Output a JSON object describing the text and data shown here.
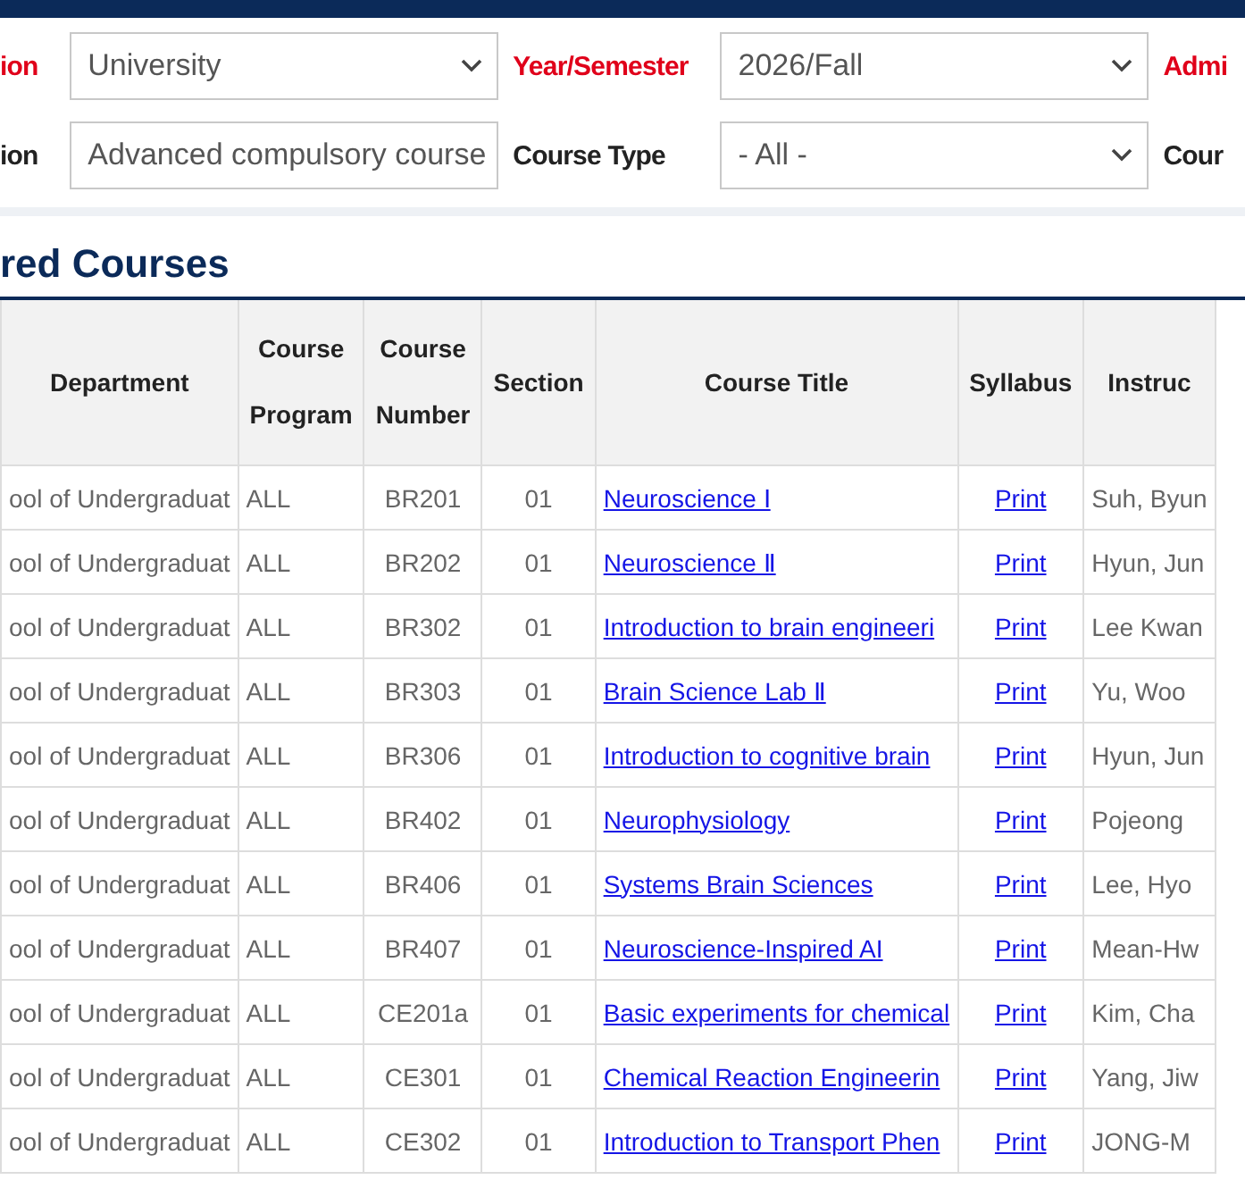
{
  "filters": [
    {
      "label": "ion",
      "required": true,
      "value": "University"
    },
    {
      "label": "Year/Semester",
      "required": true,
      "value": "2026/Fall"
    },
    {
      "label": "Admi",
      "required": true
    },
    {
      "label": "ion",
      "required": false,
      "value": "Advanced compulsory course"
    },
    {
      "label": "Course Type",
      "required": false,
      "value": "- All -"
    },
    {
      "label": "Cour",
      "required": false
    }
  ],
  "section_title": "red Courses",
  "table": {
    "columns": [
      [
        "Department"
      ],
      [
        "Course",
        "Program"
      ],
      [
        "Course",
        "Number"
      ],
      [
        "Section"
      ],
      [
        "Course Title"
      ],
      [
        "Syllabus"
      ],
      [
        "Instruc"
      ]
    ],
    "rows": [
      {
        "department": "ool of Undergraduat",
        "program": "ALL",
        "number": "BR201",
        "section": "01",
        "title": "Neuroscience Ⅰ",
        "syllabus": "Print",
        "instructor": "Suh, Byun"
      },
      {
        "department": "ool of Undergraduat",
        "program": "ALL",
        "number": "BR202",
        "section": "01",
        "title": "Neuroscience Ⅱ",
        "syllabus": "Print",
        "instructor": "Hyun, Jun"
      },
      {
        "department": "ool of Undergraduat",
        "program": "ALL",
        "number": "BR302",
        "section": "01",
        "title": "Introduction to brain engineeri",
        "syllabus": "Print",
        "instructor": "Lee Kwan"
      },
      {
        "department": "ool of Undergraduat",
        "program": "ALL",
        "number": "BR303",
        "section": "01",
        "title": "Brain Science Lab Ⅱ",
        "syllabus": "Print",
        "instructor": "Yu, Woo"
      },
      {
        "department": "ool of Undergraduat",
        "program": "ALL",
        "number": "BR306",
        "section": "01",
        "title": "Introduction to cognitive brain",
        "syllabus": "Print",
        "instructor": "Hyun, Jun"
      },
      {
        "department": "ool of Undergraduat",
        "program": "ALL",
        "number": "BR402",
        "section": "01",
        "title": "Neurophysiology",
        "syllabus": "Print",
        "instructor": "Pojeong"
      },
      {
        "department": "ool of Undergraduat",
        "program": "ALL",
        "number": "BR406",
        "section": "01",
        "title": "Systems Brain Sciences",
        "syllabus": "Print",
        "instructor": "Lee, Hyo"
      },
      {
        "department": "ool of Undergraduat",
        "program": "ALL",
        "number": "BR407",
        "section": "01",
        "title": "Neuroscience-Inspired AI",
        "syllabus": "Print",
        "instructor": "Mean-Hw"
      },
      {
        "department": "ool of Undergraduat",
        "program": "ALL",
        "number": "CE201a",
        "section": "01",
        "title": "Basic experiments for chemical",
        "syllabus": "Print",
        "instructor": "Kim, Cha"
      },
      {
        "department": "ool of Undergraduat",
        "program": "ALL",
        "number": "CE301",
        "section": "01",
        "title": "Chemical Reaction Engineerin",
        "syllabus": "Print",
        "instructor": "Yang, Jiw"
      },
      {
        "department": "ool of Undergraduat",
        "program": "ALL",
        "number": "CE302",
        "section": "01",
        "title": "Introduction to Transport Phen",
        "syllabus": "Print",
        "instructor": "JONG-M"
      }
    ]
  }
}
